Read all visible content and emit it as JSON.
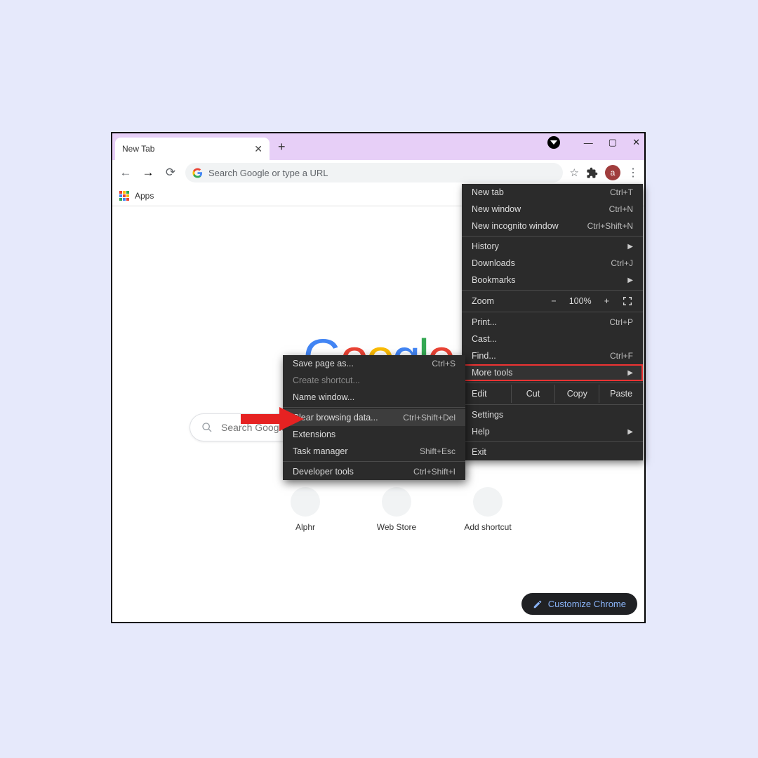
{
  "tab": {
    "title": "New Tab"
  },
  "omnibox": {
    "placeholder": "Search Google or type a URL"
  },
  "bookmark_bar": {
    "apps": "Apps"
  },
  "avatar": {
    "letter": "a"
  },
  "logo": {
    "letters": [
      "G",
      "o",
      "o",
      "g",
      "l",
      "e"
    ]
  },
  "search": {
    "placeholder": "Search Google or type a URL"
  },
  "shortcuts": [
    {
      "label": "Alphr"
    },
    {
      "label": "Web Store"
    },
    {
      "label": "Add shortcut"
    }
  ],
  "customize": {
    "label": "Customize Chrome"
  },
  "menu": {
    "new_tab": {
      "label": "New tab",
      "key": "Ctrl+T"
    },
    "new_window": {
      "label": "New window",
      "key": "Ctrl+N"
    },
    "incognito": {
      "label": "New incognito window",
      "key": "Ctrl+Shift+N"
    },
    "history": {
      "label": "History"
    },
    "downloads": {
      "label": "Downloads",
      "key": "Ctrl+J"
    },
    "bookmarks": {
      "label": "Bookmarks"
    },
    "zoom": {
      "label": "Zoom",
      "value": "100%"
    },
    "print": {
      "label": "Print...",
      "key": "Ctrl+P"
    },
    "cast": {
      "label": "Cast..."
    },
    "find": {
      "label": "Find...",
      "key": "Ctrl+F"
    },
    "more_tools": {
      "label": "More tools"
    },
    "edit": {
      "label": "Edit",
      "cut": "Cut",
      "copy": "Copy",
      "paste": "Paste"
    },
    "settings": {
      "label": "Settings"
    },
    "help": {
      "label": "Help"
    },
    "exit": {
      "label": "Exit"
    }
  },
  "submenu": {
    "save_page": {
      "label": "Save page as...",
      "key": "Ctrl+S"
    },
    "create_shortcut": {
      "label": "Create shortcut..."
    },
    "name_window": {
      "label": "Name window..."
    },
    "clear_browsing": {
      "label": "Clear browsing data...",
      "key": "Ctrl+Shift+Del"
    },
    "extensions": {
      "label": "Extensions"
    },
    "task_manager": {
      "label": "Task manager",
      "key": "Shift+Esc"
    },
    "developer_tools": {
      "label": "Developer tools",
      "key": "Ctrl+Shift+I"
    }
  }
}
